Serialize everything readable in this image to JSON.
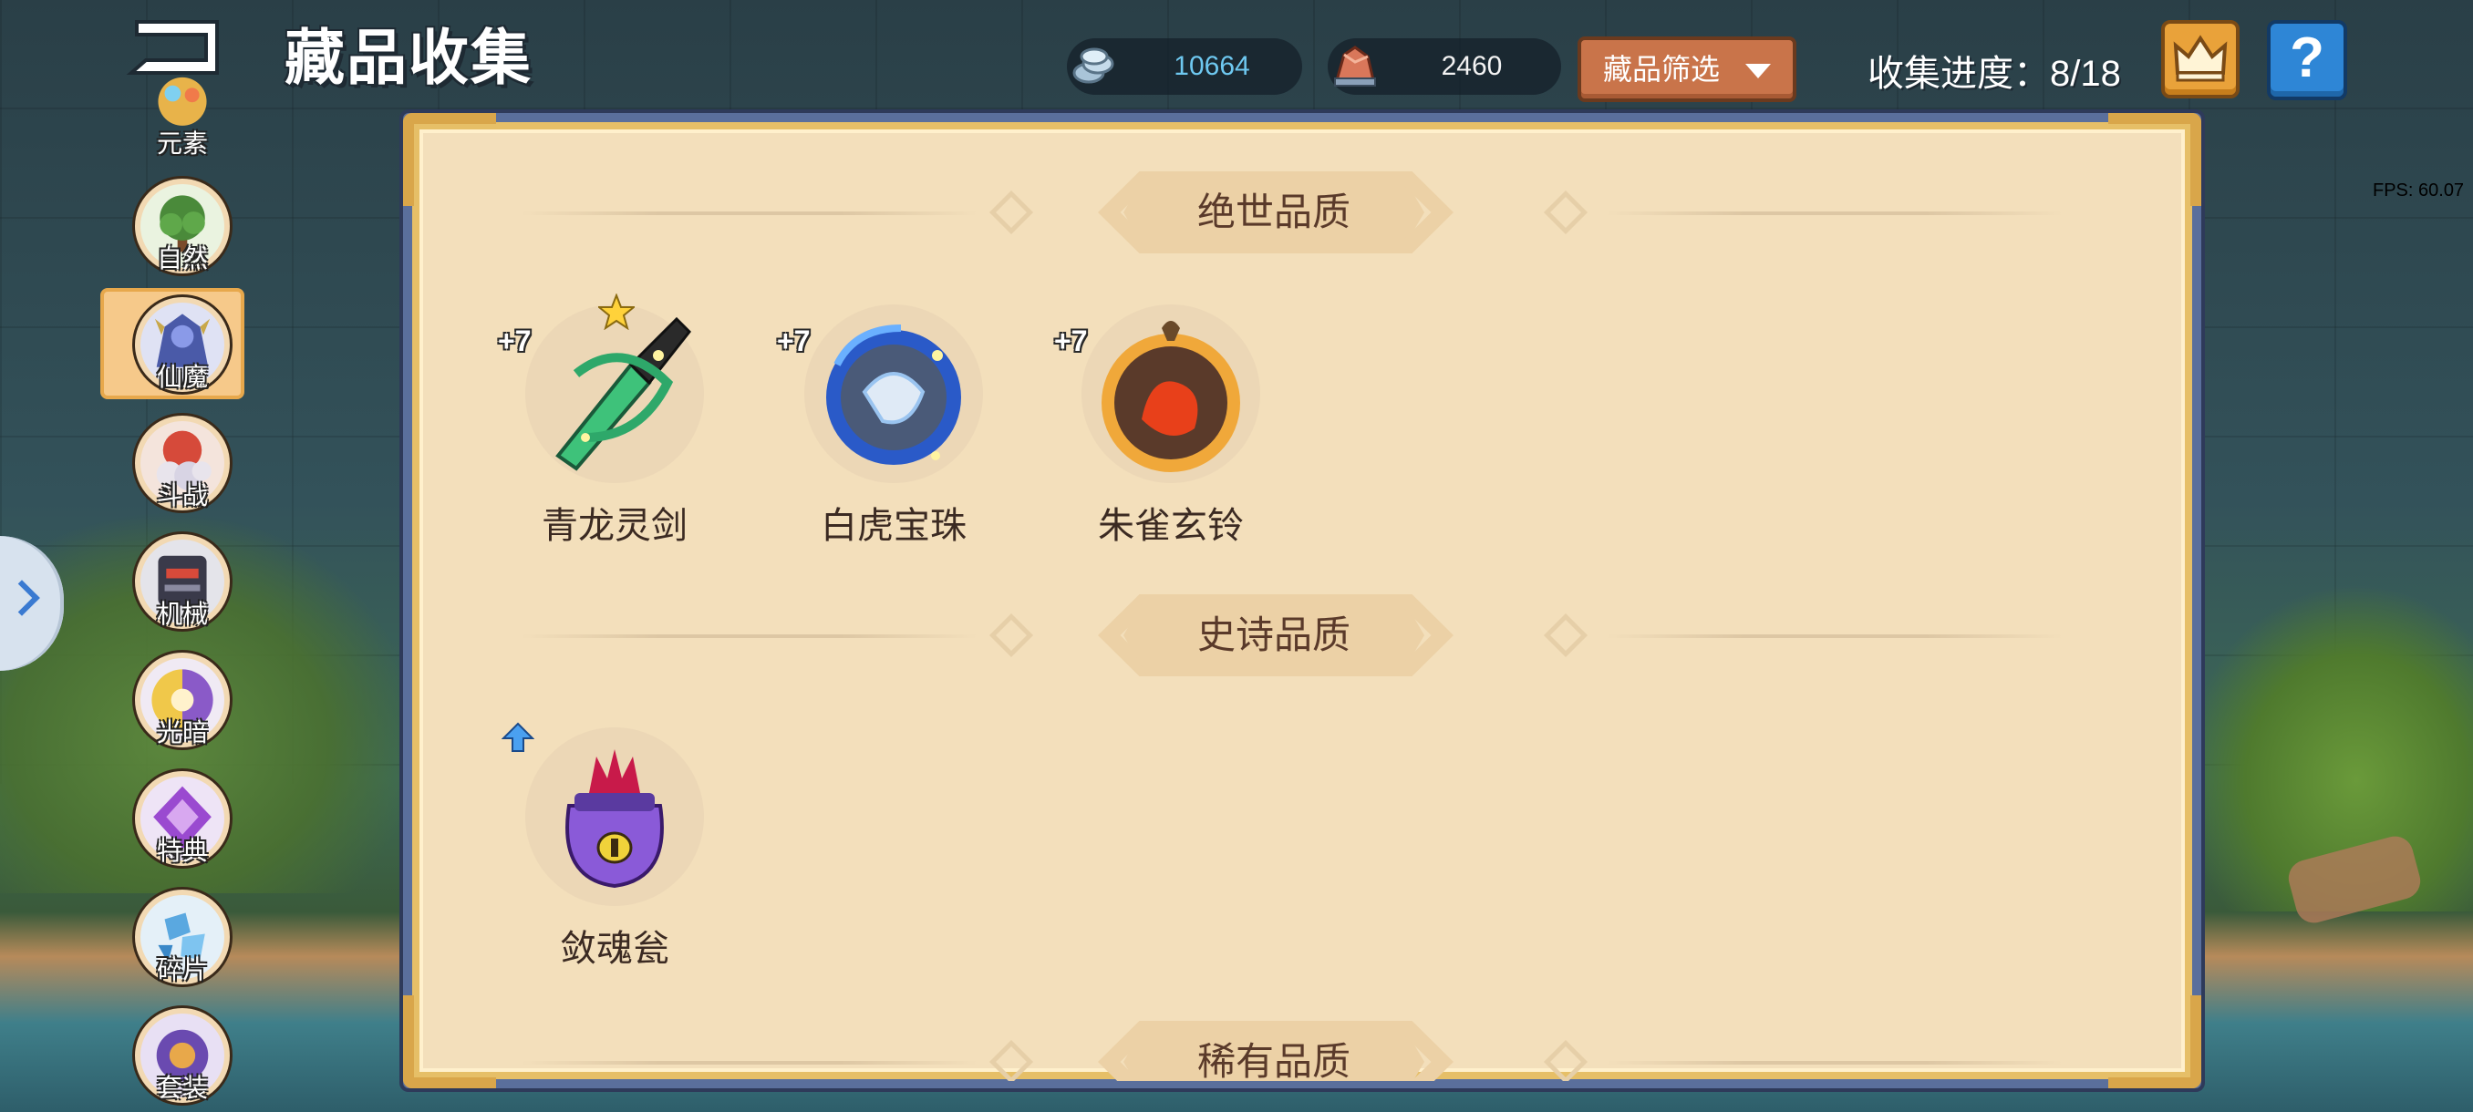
{
  "header": {
    "title": "藏品收集",
    "silver_amount": "10664",
    "gem_amount": "2460",
    "filter_label": "藏品筛选",
    "progress_label": "收集进度：",
    "progress_value": "8/18"
  },
  "fps": "FPS: 60.07",
  "sidebar": {
    "items": [
      {
        "label": "元素",
        "color": "#e8b34a"
      },
      {
        "label": "自然",
        "color": "#4a8a3a"
      },
      {
        "label": "仙魔",
        "color": "#4a5aa8",
        "selected": true
      },
      {
        "label": "斗战",
        "color": "#d64a3a"
      },
      {
        "label": "机械",
        "color": "#3a3a4a"
      },
      {
        "label": "光暗",
        "color": "#8a5ac8"
      },
      {
        "label": "特典",
        "color": "#9a4ad0"
      },
      {
        "label": "碎片",
        "color": "#5aa8e0"
      },
      {
        "label": "套装",
        "color": "#6a4ab0"
      }
    ]
  },
  "sections": [
    {
      "title": "绝世品质",
      "items": [
        {
          "name": "青龙灵剑",
          "level": "+7",
          "starred": true,
          "icon": "green-dragon-sword-icon"
        },
        {
          "name": "白虎宝珠",
          "level": "+7",
          "icon": "white-tiger-orb-icon"
        },
        {
          "name": "朱雀玄铃",
          "level": "+7",
          "icon": "vermilion-bird-bell-icon"
        }
      ]
    },
    {
      "title": "史诗品质",
      "items": [
        {
          "name": "敛魂瓮",
          "upgradable": true,
          "icon": "soul-urn-icon"
        }
      ]
    },
    {
      "title": "稀有品质",
      "items": []
    }
  ],
  "colors": {
    "panel_bg": "#f3dfbb",
    "panel_border": "#5a6f9c",
    "filter_button": "#c9744a",
    "help_button": "#2e86d6",
    "crown_button": "#e9a23a",
    "silver_text": "#6ec8f0"
  }
}
